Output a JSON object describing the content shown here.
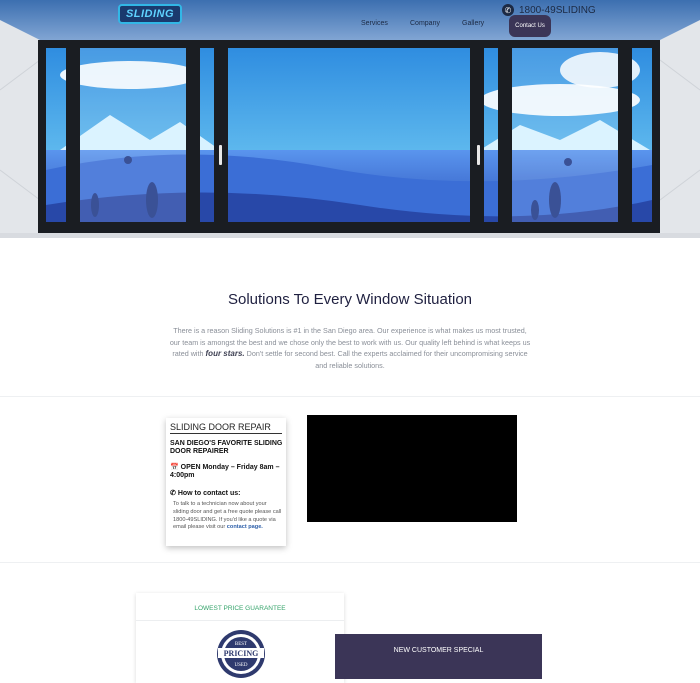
{
  "header": {
    "logo_text": "SLIDING",
    "phone": "1800-49SLIDING",
    "nav": [
      "Services",
      "Company",
      "Gallery"
    ],
    "contact_label": "Contact Us"
  },
  "intro": {
    "title": "Solutions To Every Window Situation",
    "text_before": "There is a reason Sliding Solutions is #1 in the San Diego area. Our experience is what makes us most trusted, our team is amongst the best and we chose only the best to work with us. Our quality left behind is what keeps us rated with ",
    "bold": "four stars.",
    "text_after": " Don't settle for second best. Call the experts acclaimed for their uncompromising service and reliable solutions."
  },
  "info_card": {
    "title": "SLIDING DOOR REPAIR",
    "subtitle": "SAN DIEGO'S FAVORITE SLIDING DOOR REPAIRER",
    "hours": "OPEN Monday – Friday 8am – 4:00pm",
    "contact_heading": "How to contact us:",
    "contact_text": "To talk to a technician now about your sliding door and get a free quote please call 1800-49SLIDING. If you'd like a quote via email please visit our ",
    "contact_link": "contact page."
  },
  "guarantee": {
    "title": "LOWEST PRICE GUARANTEE",
    "badge_top": "BEST",
    "badge_main": "PRICING",
    "badge_bottom": "USED"
  },
  "special": {
    "title": "NEW CUSTOMER SPECIAL"
  }
}
